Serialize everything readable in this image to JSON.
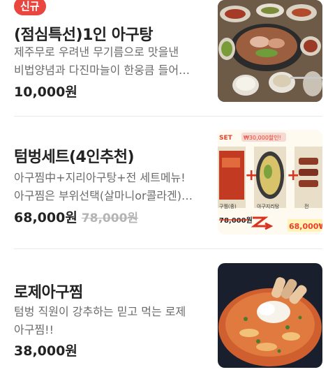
{
  "menu_items": [
    {
      "badge": "신규",
      "title": "(점심특선)1인 아구탕",
      "desc_line1": "제주무로 우려낸 무기름으로 맛을낸",
      "desc_line2": "비법양념과 다진마늘이 한웅큼 들어…",
      "price": "10,000원",
      "image": "agu-soup-set-photo"
    },
    {
      "title": "텀벙세트(4인추천)",
      "desc_line1": "아구찜中+지리아구탕+전 세트메뉴!",
      "desc_line2": "아구찜은 부위선택(살마니or콜라겐)…",
      "price": "68,000원",
      "original_price": "78,000원",
      "image": "tumbeong-set-menu-board",
      "image_text": {
        "set_label": "SET",
        "promo": "₩30,000할인!",
        "card1": "구찜(중)",
        "card2": "아구지리탕",
        "card3": "전",
        "old_price": "78,000원",
        "new_price": "68,000₩"
      }
    },
    {
      "title": "로제아구찜",
      "desc_line1": "텀벙 직원이 강추하는 믿고 먹는 로제",
      "desc_line2": "아구찜!!",
      "price": "38,000원",
      "image": "rose-agujjim-photo"
    }
  ],
  "colors": {
    "badge": "#e8463f",
    "title": "#222222",
    "desc": "#6b6b6b",
    "strike": "#b5b5b5",
    "divider": "#e9e9e9"
  }
}
